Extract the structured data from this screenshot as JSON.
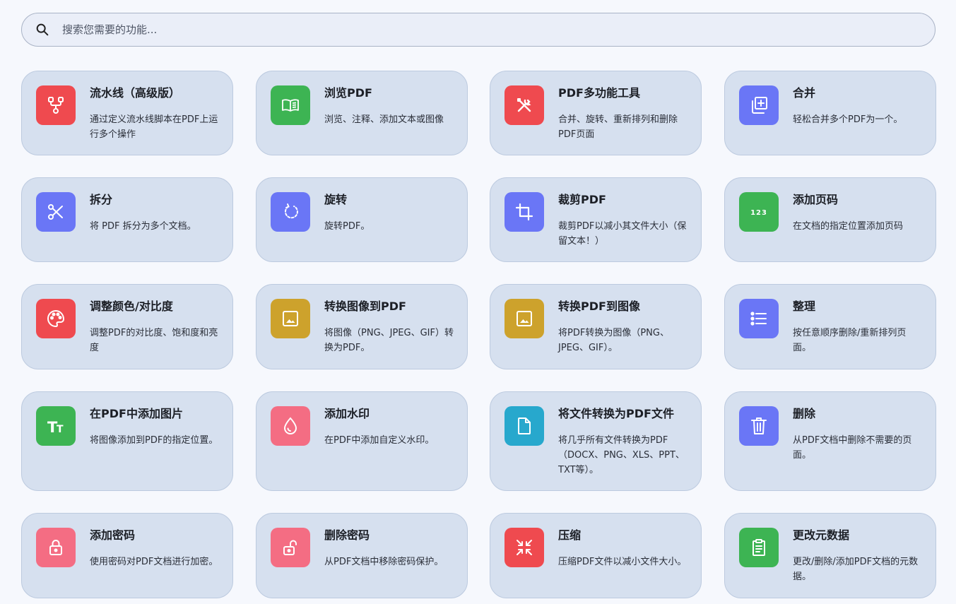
{
  "search": {
    "placeholder": "搜索您需要的功能...",
    "icon": "search-icon"
  },
  "colors": {
    "red": "#ef4a4f",
    "green": "#3db453",
    "indigo": "#6a76f6",
    "gold": "#cda22c",
    "pink": "#f46d83",
    "teal": "#27a8cd",
    "card_bg": "#d6e0ef",
    "page_bg": "#f6f8fd"
  },
  "tools": [
    {
      "title": "流水线（高级版）",
      "desc": "通过定义流水线脚本在PDF上运行多个操作",
      "icon": "pipeline-icon",
      "color": "#ef4a4f"
    },
    {
      "title": "浏览PDF",
      "desc": "浏览、注释、添加文本或图像",
      "icon": "book-open-icon",
      "color": "#3db453"
    },
    {
      "title": "PDF多功能工具",
      "desc": "合并、旋转、重新排列和删除PDF页面",
      "icon": "tools-icon",
      "color": "#ef4a4f"
    },
    {
      "title": "合并",
      "desc": "轻松合并多个PDF为一个。",
      "icon": "library-add-icon",
      "color": "#6a76f6"
    },
    {
      "title": "拆分",
      "desc": "将 PDF 拆分为多个文档。",
      "icon": "scissors-icon",
      "color": "#6a76f6"
    },
    {
      "title": "旋转",
      "desc": "旋转PDF。",
      "icon": "rotate-icon",
      "color": "#6a76f6"
    },
    {
      "title": "裁剪PDF",
      "desc": "裁剪PDF以减小其文件大小（保留文本！）",
      "icon": "crop-icon",
      "color": "#6a76f6"
    },
    {
      "title": "添加页码",
      "desc": "在文档的指定位置添加页码",
      "icon": "numbers-icon",
      "color": "#3db453"
    },
    {
      "title": "调整颜色/对比度",
      "desc": "调整PDF的对比度、饱和度和亮度",
      "icon": "palette-icon",
      "color": "#ef4a4f"
    },
    {
      "title": "转换图像到PDF",
      "desc": "将图像（PNG、JPEG、GIF）转换为PDF。",
      "icon": "image-icon",
      "color": "#cda22c"
    },
    {
      "title": "转换PDF到图像",
      "desc": "将PDF转换为图像（PNG、JPEG、GIF）。",
      "icon": "image-icon",
      "color": "#cda22c"
    },
    {
      "title": "整理",
      "desc": "按任意顺序删除/重新排列页面。",
      "icon": "list-icon",
      "color": "#6a76f6"
    },
    {
      "title": "在PDF中添加图片",
      "desc": "将图像添加到PDF的指定位置。",
      "icon": "text-fields-icon",
      "color": "#3db453"
    },
    {
      "title": "添加水印",
      "desc": "在PDF中添加自定义水印。",
      "icon": "water-drop-icon",
      "color": "#f46d83"
    },
    {
      "title": "将文件转换为PDF文件",
      "desc": "将几乎所有文件转换为PDF（DOCX、PNG、XLS、PPT、TXT等）。",
      "icon": "file-icon",
      "color": "#27a8cd"
    },
    {
      "title": "删除",
      "desc": "从PDF文档中删除不需要的页面。",
      "icon": "trash-icon",
      "color": "#6a76f6"
    },
    {
      "title": "添加密码",
      "desc": "使用密码对PDF文档进行加密。",
      "icon": "lock-icon",
      "color": "#f46d83"
    },
    {
      "title": "删除密码",
      "desc": "从PDF文档中移除密码保护。",
      "icon": "lock-open-icon",
      "color": "#f46d83"
    },
    {
      "title": "压缩",
      "desc": "压缩PDF文件以减小文件大小。",
      "icon": "compress-icon",
      "color": "#ef4a4f"
    },
    {
      "title": "更改元数据",
      "desc": "更改/删除/添加PDF文档的元数据。",
      "icon": "clipboard-icon",
      "color": "#3db453"
    }
  ]
}
